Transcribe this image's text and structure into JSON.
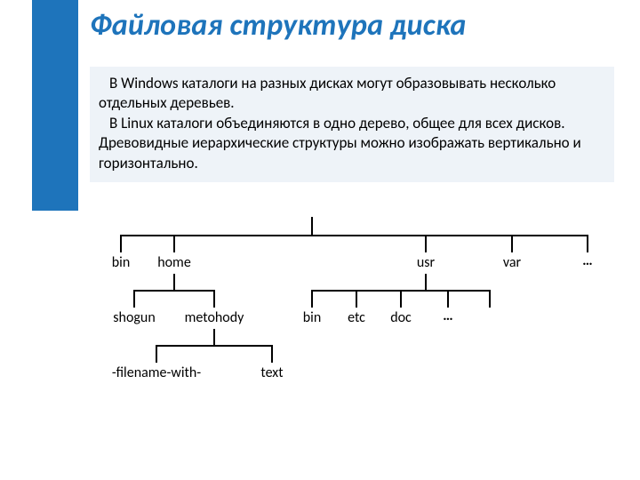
{
  "title": "Файловая структура диска",
  "description": {
    "p1": "В Windows каталоги на разных дисках могут образовывать несколько отдельных деревьев.",
    "p2": "В Linux каталоги объединяются в одно дерево, общее для всех дисков. Древовидные иерархические структуры можно изображать вертикально и горизонтально."
  },
  "tree": {
    "level1": {
      "n0": "bin",
      "n1": "home",
      "n2": "usr",
      "n3": "var",
      "n4": "…"
    },
    "level2_home": {
      "n0": "shogun",
      "n1": "metohody"
    },
    "level2_usr": {
      "n0": "bin",
      "n1": "etc",
      "n2": "doc",
      "n3": "…"
    },
    "level3_metohody": {
      "n0": "-filename-with-",
      "n1": "text"
    }
  },
  "colors": {
    "brand": "#1e74bb",
    "descBg": "#eef3f8"
  }
}
